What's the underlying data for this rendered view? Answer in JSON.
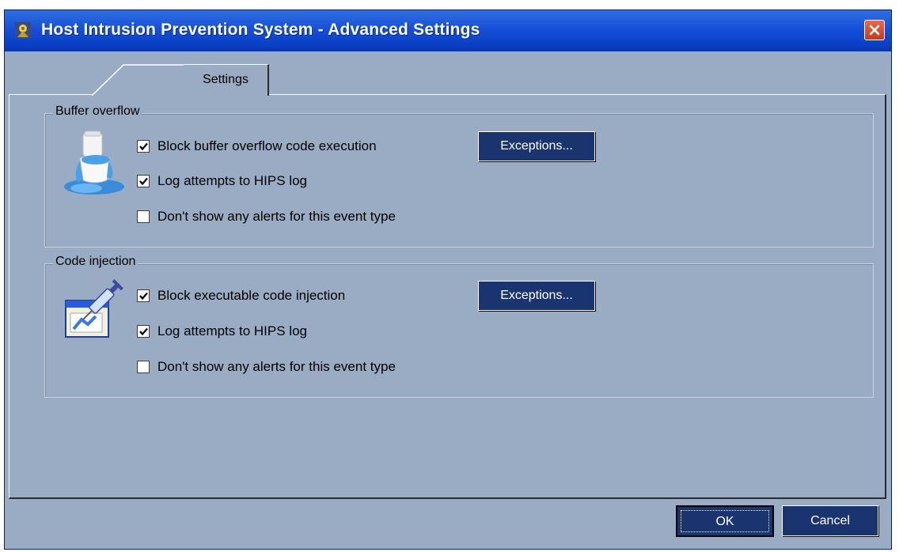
{
  "window": {
    "title": "Host Intrusion Prevention System - Advanced Settings"
  },
  "tabs": [
    {
      "label": "Settings",
      "active": true
    }
  ],
  "groups": [
    {
      "title": "Buffer overflow",
      "illustration_icon": "overflowing-toilet-icon",
      "checkboxes": [
        {
          "label": "Block buffer overflow code execution",
          "checked": true
        },
        {
          "label": "Log attempts to HIPS log",
          "checked": true
        },
        {
          "label": "Don't show any alerts for this event type",
          "checked": false
        }
      ],
      "exceptions_label": "Exceptions..."
    },
    {
      "title": "Code injection",
      "illustration_icon": "syringe-injection-icon",
      "checkboxes": [
        {
          "label": "Block executable code injection",
          "checked": true
        },
        {
          "label": "Log attempts to HIPS log",
          "checked": true
        },
        {
          "label": "Don't show any alerts for this event type",
          "checked": false
        }
      ],
      "exceptions_label": "Exceptions..."
    }
  ],
  "footer": {
    "ok_label": "OK",
    "cancel_label": "Cancel"
  },
  "colors": {
    "dialog_background": "#9aabc4",
    "title_bar": "#1650d8",
    "button_background": "#1a3470"
  }
}
